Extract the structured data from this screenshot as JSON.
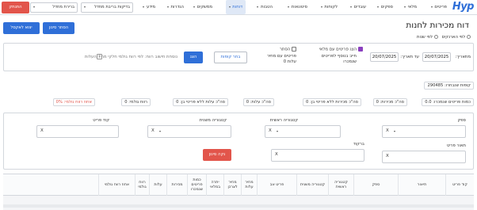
{
  "nav": {
    "logo": "Hyp",
    "items": [
      {
        "label": "פריטים"
      },
      {
        "label": "מלאי"
      },
      {
        "label": "ספקים"
      },
      {
        "label": "עובדים"
      },
      {
        "label": "לקוחות"
      },
      {
        "label": "סיטונאות"
      },
      {
        "label": "הטבות"
      },
      {
        "label": "דוחות"
      },
      {
        "label": "ממשקים"
      },
      {
        "label": "הגדרות"
      },
      {
        "label": "מידע"
      }
    ],
    "active_index": 7,
    "select_test": "בדיקות בריבת מחדל",
    "select_default": "ברירת מחדל",
    "logout": "התנתק"
  },
  "page": {
    "title": "דוח מכירות לחנות",
    "radio_by_suppliers": "לפי הארנקים",
    "radio_by_years": "לפי שנות",
    "btn_hide_filter": "הסתר סינון",
    "btn_export_excel": "יצוא לאקסל"
  },
  "filters": {
    "from_date_label": "מתאריך:",
    "from_date": "20/07/2025",
    "to_date_label": "עד תאריך:",
    "to_date": "20/07/2025",
    "cb_with_stock_label": "הצג פריטים עם מלאי",
    "cb_with_stock_sub": "חייב בנוסף לפריטים שנמכרו",
    "cb_hide_label": "הסתר",
    "cb_hide_sub": "פריטים עם מחיר עלות 0",
    "btn_choose_branches": "בחר קופות",
    "btn_show": "הצג",
    "profit_note": "נוסחת חישוב רווח: לפי רווח גולמי חלקי מחיר העלות",
    "info_icon_text": "?"
  },
  "counts": {
    "branches_sold_label": "קופות שנבחרו:",
    "branches_sold_value": "290485",
    "summary": [
      {
        "label": "כמות פריטים שנמכרו:",
        "value": "0.0"
      },
      {
        "label": "סה\"כ מכירות:",
        "value": "0"
      },
      {
        "label": "סה\"כ מכירות ללא פריטי בן:",
        "value": "0"
      },
      {
        "label": "סה\"כ עלות:",
        "value": "0"
      },
      {
        "label": "סה\"כ עלות ללא פריטי בן:",
        "value": "0"
      },
      {
        "label": "רווח גולמי:",
        "value": "0"
      },
      {
        "label": "אחוז רווח גולמי:",
        "value": "0%"
      }
    ]
  },
  "panel": {
    "supplier_label": "ספק",
    "main_category_label": "קטגוריה ראשית",
    "item_code_label": "קוד פריט",
    "item_desc_label": "תאור פריט",
    "barcode_label": "ברקוד",
    "sub_category_label": "קטגוריה משנית",
    "clear_x": "X",
    "btn_clear_filter": "נקה סינון"
  },
  "table": {
    "headers": [
      "קוד פריט",
      "תיאור",
      "ספק",
      "קטגוריה ראשית",
      "קטגוריה משנית",
      "פריט אב",
      "מחיר עלות",
      "מחיר לצרכן",
      "יתרה במלאי",
      "כמות פריטים שנמכרו",
      "מכירות",
      "עלות",
      "רווח גולמי",
      "אחוז רווח גולמי"
    ]
  },
  "colors": {
    "accent_blue": "#2f6fd8",
    "danger_red": "#e2554b",
    "checkbox_purple": "#8a3fbf",
    "percent_red": "#e2554b"
  }
}
